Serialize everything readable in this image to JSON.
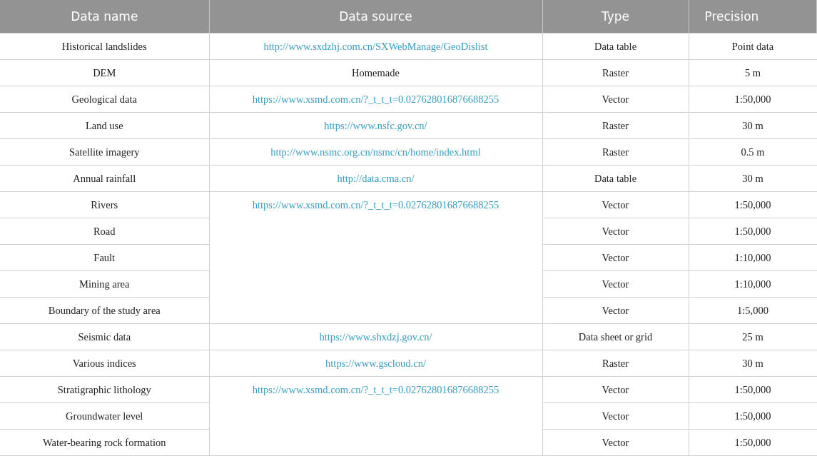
{
  "table": {
    "columns": [
      "Data name",
      "Data source",
      "Type",
      "Precision"
    ],
    "groups": [
      {
        "source": {
          "kind": "link",
          "text": "http://www.sxdzhj.com.cn/SXWebManage/GeoDislist"
        },
        "rows": [
          {
            "name": "Historical landslides",
            "type": "Data table",
            "precision": "Point data"
          }
        ]
      },
      {
        "source": {
          "kind": "text",
          "text": "Homemade"
        },
        "rows": [
          {
            "name": "DEM",
            "type": "Raster",
            "precision": "5 m"
          }
        ]
      },
      {
        "source": {
          "kind": "link",
          "text": "https://www.xsmd.com.cn/?_t_t_t=0.027628016876688255"
        },
        "rows": [
          {
            "name": "Geological data",
            "type": "Vector",
            "precision": "1:50,000"
          }
        ]
      },
      {
        "source": {
          "kind": "link",
          "text": "https://www.nsfc.gov.cn/"
        },
        "rows": [
          {
            "name": "Land use",
            "type": "Raster",
            "precision": "30 m"
          }
        ]
      },
      {
        "source": {
          "kind": "link",
          "text": "http://www.nsmc.org.cn/nsmc/cn/home/index.html"
        },
        "rows": [
          {
            "name": "Satellite imagery",
            "type": "Raster",
            "precision": "0.5 m"
          }
        ]
      },
      {
        "source": {
          "kind": "link",
          "text": "http://data.cma.cn/"
        },
        "rows": [
          {
            "name": "Annual rainfall",
            "type": "Data table",
            "precision": "30 m"
          }
        ]
      },
      {
        "source": {
          "kind": "link",
          "text": "https://www.xsmd.com.cn/?_t_t_t=0.027628016876688255"
        },
        "rows": [
          {
            "name": "Rivers",
            "type": "Vector",
            "precision": "1:50,000"
          },
          {
            "name": "Road",
            "type": "Vector",
            "precision": "1:50,000"
          },
          {
            "name": "Fault",
            "type": "Vector",
            "precision": "1:10,000"
          },
          {
            "name": "Mining area",
            "type": "Vector",
            "precision": "1:10,000"
          },
          {
            "name": "Boundary of the study area",
            "type": "Vector",
            "precision": "1:5,000"
          }
        ]
      },
      {
        "source": {
          "kind": "link",
          "text": "https://www.shxdzj.gov.cn/"
        },
        "rows": [
          {
            "name": "Seismic data",
            "type": "Data sheet or grid",
            "precision": "25 m"
          }
        ]
      },
      {
        "source": {
          "kind": "link",
          "text": "https://www.gscloud.cn/"
        },
        "rows": [
          {
            "name": "Various indices",
            "type": "Raster",
            "precision": "30 m"
          }
        ]
      },
      {
        "source": {
          "kind": "link",
          "text": "https://www.xsmd.com.cn/?_t_t_t=0.027628016876688255"
        },
        "rows": [
          {
            "name": "Stratigraphic lithology",
            "type": "Vector",
            "precision": "1:50,000"
          },
          {
            "name": "Groundwater level",
            "type": "Vector",
            "precision": "1:50,000"
          },
          {
            "name": "Water-bearing rock formation",
            "type": "Vector",
            "precision": "1:50,000"
          }
        ]
      }
    ]
  }
}
